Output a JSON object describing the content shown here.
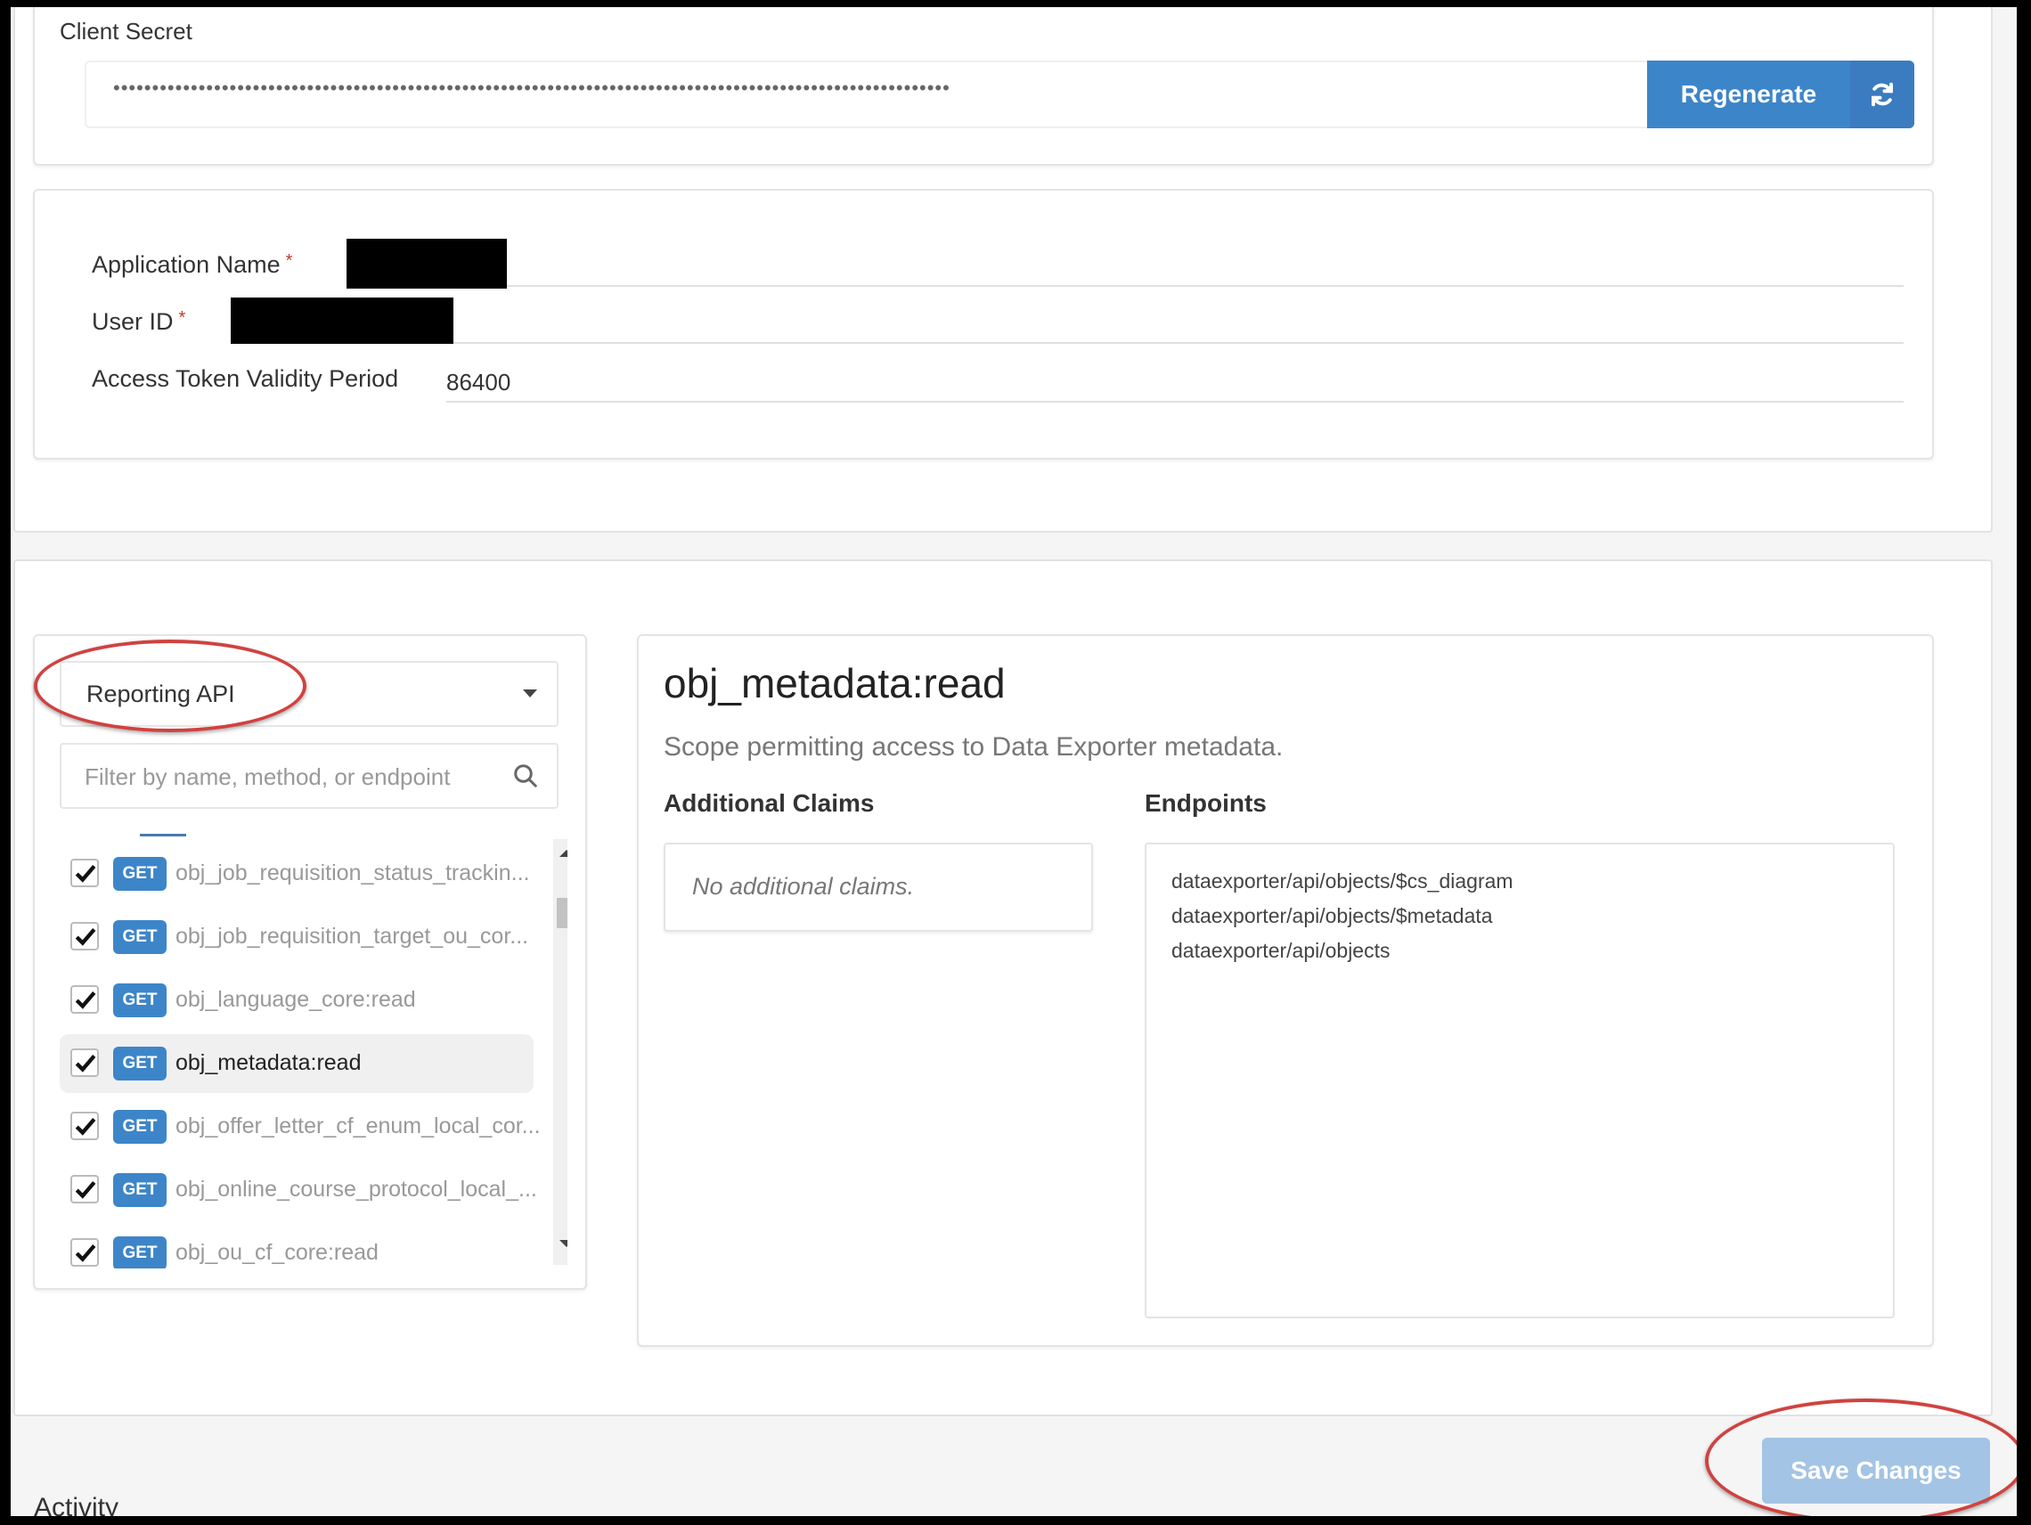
{
  "client_secret": {
    "label": "Client Secret",
    "masked_value": "••••••••••••••••••••••••••••••••••••••••••••••••••••••••••••••••••••••••••••••••••••••••••••••••••••••••••••",
    "regenerate_label": "Regenerate",
    "regenerate_icon": "refresh-icon"
  },
  "app_details": {
    "application_name_label": "Application Name",
    "user_id_label": "User ID",
    "required_marker": "*",
    "access_token_label": "Access Token Validity Period",
    "access_token_value": "86400"
  },
  "scopes": {
    "api_select": {
      "selected": "Reporting API"
    },
    "filter": {
      "placeholder": "Filter by name, method, or endpoint",
      "value": ""
    },
    "items": [
      {
        "method": "GET",
        "name": "obj_job_requisition_status_trackin...",
        "checked": true,
        "active": false
      },
      {
        "method": "GET",
        "name": "obj_job_requisition_target_ou_cor...",
        "checked": true,
        "active": false
      },
      {
        "method": "GET",
        "name": "obj_language_core:read",
        "checked": true,
        "active": false
      },
      {
        "method": "GET",
        "name": "obj_metadata:read",
        "checked": true,
        "active": true
      },
      {
        "method": "GET",
        "name": "obj_offer_letter_cf_enum_local_cor...",
        "checked": true,
        "active": false
      },
      {
        "method": "GET",
        "name": "obj_online_course_protocol_local_...",
        "checked": true,
        "active": false
      },
      {
        "method": "GET",
        "name": "obj_ou_cf_core:read",
        "checked": true,
        "active": false
      }
    ]
  },
  "scope_detail": {
    "title": "obj_metadata:read",
    "description": "Scope permitting access to Data Exporter metadata.",
    "claims_heading": "Additional Claims",
    "claims_empty": "No additional claims.",
    "endpoints_heading": "Endpoints",
    "endpoints": [
      "dataexporter/api/objects/$cs_diagram",
      "dataexporter/api/objects/$metadata",
      "dataexporter/api/objects"
    ]
  },
  "footer": {
    "save_label": "Save Changes",
    "activity_heading": "Activity"
  },
  "colors": {
    "primary": "#3d85c9",
    "primary_disabled": "#a3c4e4",
    "annotation": "#d0423f"
  }
}
